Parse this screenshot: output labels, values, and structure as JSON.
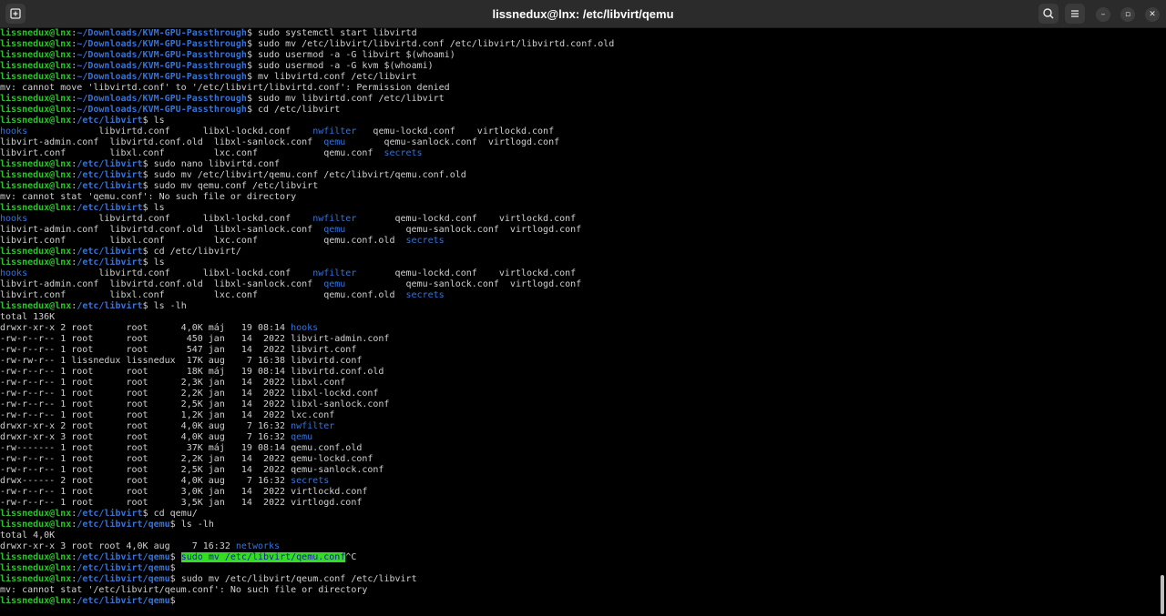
{
  "window": {
    "title": "lissnedux@lnx: /etc/libvirt/qemu",
    "new_tab_icon": "new-tab-icon",
    "search_icon": "search-icon",
    "menu_icon": "hamburger-menu-icon",
    "minimize_glyph": "–",
    "maximize_glyph": "▫",
    "close_glyph": "✕"
  },
  "colors": {
    "background": "#000000",
    "titlebar": "#2b2b2b",
    "prompt_user": "#2ec22e",
    "prompt_path": "#3672d6",
    "executable_files": "#2ec22e",
    "directories": "#3672d6",
    "selection_bg": "#33dd22"
  },
  "terminal": {
    "lines": [
      [
        [
          "u",
          "lissnedux@lnx"
        ],
        [
          "t",
          ":"
        ],
        [
          "p",
          "~/Downloads/KVM-GPU-Passthrough"
        ],
        [
          "t",
          "$ sudo systemctl start libvirtd"
        ]
      ],
      [
        [
          "u",
          "lissnedux@lnx"
        ],
        [
          "t",
          ":"
        ],
        [
          "p",
          "~/Downloads/KVM-GPU-Passthrough"
        ],
        [
          "t",
          "$ sudo mv /etc/libvirt/libvirtd.conf /etc/libvirt/libvirtd.conf.old"
        ]
      ],
      [
        [
          "u",
          "lissnedux@lnx"
        ],
        [
          "t",
          ":"
        ],
        [
          "p",
          "~/Downloads/KVM-GPU-Passthrough"
        ],
        [
          "t",
          "$ sudo usermod -a -G libvirt $(whoami)"
        ]
      ],
      [
        [
          "u",
          "lissnedux@lnx"
        ],
        [
          "t",
          ":"
        ],
        [
          "p",
          "~/Downloads/KVM-GPU-Passthrough"
        ],
        [
          "t",
          "$ sudo usermod -a -G kvm $(whoami)"
        ]
      ],
      [
        [
          "u",
          "lissnedux@lnx"
        ],
        [
          "t",
          ":"
        ],
        [
          "p",
          "~/Downloads/KVM-GPU-Passthrough"
        ],
        [
          "t",
          "$ mv libvirtd.conf /etc/libvirt"
        ]
      ],
      [
        [
          "t",
          "mv: cannot move 'libvirtd.conf' to '/etc/libvirt/libvirtd.conf': Permission denied"
        ]
      ],
      [
        [
          "u",
          "lissnedux@lnx"
        ],
        [
          "t",
          ":"
        ],
        [
          "p",
          "~/Downloads/KVM-GPU-Passthrough"
        ],
        [
          "t",
          "$ sudo mv libvirtd.conf /etc/libvirt"
        ]
      ],
      [
        [
          "u",
          "lissnedux@lnx"
        ],
        [
          "t",
          ":"
        ],
        [
          "p",
          "~/Downloads/KVM-GPU-Passthrough"
        ],
        [
          "t",
          "$ cd /etc/libvirt"
        ]
      ],
      [
        [
          "u",
          "lissnedux@lnx"
        ],
        [
          "t",
          ":"
        ],
        [
          "p",
          "/etc/libvirt"
        ],
        [
          "t",
          "$ ls"
        ]
      ],
      [
        [
          "bl",
          "hooks"
        ],
        [
          "t",
          "             libvirtd.conf      libxl-lockd.conf    "
        ],
        [
          "bl",
          "nwfilter"
        ],
        [
          "t",
          "   qemu-lockd.conf    virtlockd.conf"
        ]
      ],
      [
        [
          "t",
          "libvirt-admin.conf  libvirtd.conf.old  libxl-sanlock.conf  "
        ],
        [
          "bl",
          "qemu"
        ],
        [
          "t",
          "       qemu-sanlock.conf  virtlogd.conf"
        ]
      ],
      [
        [
          "t",
          "libvirt.conf        libxl.conf         lxc.conf            qemu.conf  "
        ],
        [
          "bl",
          "secrets"
        ]
      ],
      [
        [
          "u",
          "lissnedux@lnx"
        ],
        [
          "t",
          ":"
        ],
        [
          "p",
          "/etc/libvirt"
        ],
        [
          "t",
          "$ sudo nano libvirtd.conf"
        ]
      ],
      [
        [
          "u",
          "lissnedux@lnx"
        ],
        [
          "t",
          ":"
        ],
        [
          "p",
          "/etc/libvirt"
        ],
        [
          "t",
          "$ sudo mv /etc/libvirt/qemu.conf /etc/libvirt/qemu.conf.old"
        ]
      ],
      [
        [
          "u",
          "lissnedux@lnx"
        ],
        [
          "t",
          ":"
        ],
        [
          "p",
          "/etc/libvirt"
        ],
        [
          "t",
          "$ sudo mv qemu.conf /etc/libvirt"
        ]
      ],
      [
        [
          "t",
          "mv: cannot stat 'qemu.conf': No such file or directory"
        ]
      ],
      [
        [
          "u",
          "lissnedux@lnx"
        ],
        [
          "t",
          ":"
        ],
        [
          "p",
          "/etc/libvirt"
        ],
        [
          "t",
          "$ ls"
        ]
      ],
      [
        [
          "bl",
          "hooks"
        ],
        [
          "t",
          "             libvirtd.conf      libxl-lockd.conf    "
        ],
        [
          "bl",
          "nwfilter"
        ],
        [
          "t",
          "       qemu-lockd.conf    virtlockd.conf"
        ]
      ],
      [
        [
          "t",
          "libvirt-admin.conf  libvirtd.conf.old  libxl-sanlock.conf  "
        ],
        [
          "bl",
          "qemu"
        ],
        [
          "t",
          "           qemu-sanlock.conf  virtlogd.conf"
        ]
      ],
      [
        [
          "t",
          "libvirt.conf        libxl.conf         lxc.conf            qemu.conf.old  "
        ],
        [
          "bl",
          "secrets"
        ]
      ],
      [
        [
          "u",
          "lissnedux@lnx"
        ],
        [
          "t",
          ":"
        ],
        [
          "p",
          "/etc/libvirt"
        ],
        [
          "t",
          "$ cd /etc/libvirt/"
        ]
      ],
      [
        [
          "u",
          "lissnedux@lnx"
        ],
        [
          "t",
          ":"
        ],
        [
          "p",
          "/etc/libvirt"
        ],
        [
          "t",
          "$ ls"
        ]
      ],
      [
        [
          "bl",
          "hooks"
        ],
        [
          "t",
          "             libvirtd.conf      libxl-lockd.conf    "
        ],
        [
          "bl",
          "nwfilter"
        ],
        [
          "t",
          "       qemu-lockd.conf    virtlockd.conf"
        ]
      ],
      [
        [
          "t",
          "libvirt-admin.conf  libvirtd.conf.old  libxl-sanlock.conf  "
        ],
        [
          "bl",
          "qemu"
        ],
        [
          "t",
          "           qemu-sanlock.conf  virtlogd.conf"
        ]
      ],
      [
        [
          "t",
          "libvirt.conf        libxl.conf         lxc.conf            qemu.conf.old  "
        ],
        [
          "bl",
          "secrets"
        ]
      ],
      [
        [
          "u",
          "lissnedux@lnx"
        ],
        [
          "t",
          ":"
        ],
        [
          "p",
          "/etc/libvirt"
        ],
        [
          "t",
          "$ ls -lh"
        ]
      ],
      [
        [
          "t",
          "total 136K"
        ]
      ],
      [
        [
          "t",
          "drwxr-xr-x 2 root      root      4,0K máj   19 08:14 "
        ],
        [
          "bl",
          "hooks"
        ]
      ],
      [
        [
          "t",
          "-rw-r--r-- 1 root      root       450 jan   14  2022 libvirt-admin.conf"
        ]
      ],
      [
        [
          "t",
          "-rw-r--r-- 1 root      root       547 jan   14  2022 libvirt.conf"
        ]
      ],
      [
        [
          "t",
          "-rw-rw-r-- 1 lissnedux lissnedux  17K aug    7 16:38 libvirtd.conf"
        ]
      ],
      [
        [
          "t",
          "-rw-r--r-- 1 root      root       18K máj   19 08:14 libvirtd.conf.old"
        ]
      ],
      [
        [
          "t",
          "-rw-r--r-- 1 root      root      2,3K jan   14  2022 libxl.conf"
        ]
      ],
      [
        [
          "t",
          "-rw-r--r-- 1 root      root      2,2K jan   14  2022 libxl-lockd.conf"
        ]
      ],
      [
        [
          "t",
          "-rw-r--r-- 1 root      root      2,5K jan   14  2022 libxl-sanlock.conf"
        ]
      ],
      [
        [
          "t",
          "-rw-r--r-- 1 root      root      1,2K jan   14  2022 lxc.conf"
        ]
      ],
      [
        [
          "t",
          "drwxr-xr-x 2 root      root      4,0K aug    7 16:32 "
        ],
        [
          "bl",
          "nwfilter"
        ]
      ],
      [
        [
          "t",
          "drwxr-xr-x 3 root      root      4,0K aug    7 16:32 "
        ],
        [
          "bl",
          "qemu"
        ]
      ],
      [
        [
          "t",
          "-rw------- 1 root      root       37K máj   19 08:14 qemu.conf.old"
        ]
      ],
      [
        [
          "t",
          "-rw-r--r-- 1 root      root      2,2K jan   14  2022 qemu-lockd.conf"
        ]
      ],
      [
        [
          "t",
          "-rw-r--r-- 1 root      root      2,5K jan   14  2022 qemu-sanlock.conf"
        ]
      ],
      [
        [
          "t",
          "drwx------ 2 root      root      4,0K aug    7 16:32 "
        ],
        [
          "bl",
          "secrets"
        ]
      ],
      [
        [
          "t",
          "-rw-r--r-- 1 root      root      3,0K jan   14  2022 virtlockd.conf"
        ]
      ],
      [
        [
          "t",
          "-rw-r--r-- 1 root      root      3,5K jan   14  2022 virtlogd.conf"
        ]
      ],
      [
        [
          "u",
          "lissnedux@lnx"
        ],
        [
          "t",
          ":"
        ],
        [
          "p",
          "/etc/libvirt"
        ],
        [
          "t",
          "$ cd qemu/"
        ]
      ],
      [
        [
          "u",
          "lissnedux@lnx"
        ],
        [
          "t",
          ":"
        ],
        [
          "p",
          "/etc/libvirt/qemu"
        ],
        [
          "t",
          "$ ls -lh"
        ]
      ],
      [
        [
          "t",
          "total 4,0K"
        ]
      ],
      [
        [
          "t",
          "drwxr-xr-x 3 root root 4,0K aug    7 16:32 "
        ],
        [
          "bl",
          "networks"
        ]
      ],
      [
        [
          "u",
          "lissnedux@lnx"
        ],
        [
          "t",
          ":"
        ],
        [
          "p",
          "/etc/libvirt/qemu"
        ],
        [
          "t",
          "$ "
        ],
        [
          "hl",
          "sudo mv /etc/libvirt/qemu.conf"
        ],
        [
          "t",
          "^C"
        ]
      ],
      [
        [
          "u",
          "lissnedux@lnx"
        ],
        [
          "t",
          ":"
        ],
        [
          "p",
          "/etc/libvirt/qemu"
        ],
        [
          "t",
          "$"
        ]
      ],
      [
        [
          "u",
          "lissnedux@lnx"
        ],
        [
          "t",
          ":"
        ],
        [
          "p",
          "/etc/libvirt/qemu"
        ],
        [
          "t",
          "$ sudo mv /etc/libvirt/qeum.conf /etc/libvirt"
        ]
      ],
      [
        [
          "t",
          "mv: cannot stat '/etc/libvirt/qeum.conf': No such file or directory"
        ]
      ],
      [
        [
          "u",
          "lissnedux@lnx"
        ],
        [
          "t",
          ":"
        ],
        [
          "p",
          "/etc/libvirt/qemu"
        ],
        [
          "t",
          "$"
        ]
      ]
    ]
  }
}
